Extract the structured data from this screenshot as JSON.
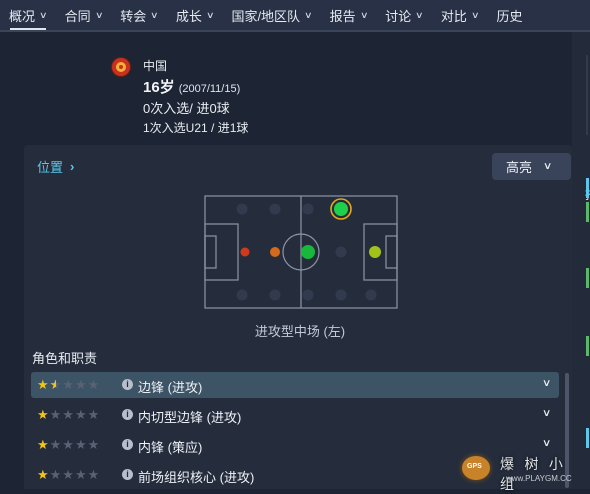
{
  "nav": {
    "tabs": [
      {
        "label": "概况",
        "active": true
      },
      {
        "label": "合同"
      },
      {
        "label": "转会"
      },
      {
        "label": "成长"
      },
      {
        "label": "国家/地区队"
      },
      {
        "label": "报告"
      },
      {
        "label": "讨论"
      },
      {
        "label": "对比"
      },
      {
        "label": "历史"
      }
    ]
  },
  "player": {
    "nation": "中国",
    "age": "16岁",
    "dob": "(2007/11/15)",
    "caps": "0次入选/ 进0球",
    "u21": "1次入选U21 / 进1球"
  },
  "position": {
    "link_label": "位置",
    "dropdown_label": "高亮",
    "position_label": "进攻型中场 (左)",
    "markers": [
      {
        "name": "amc-left",
        "color": "#1ed04a",
        "highlight": true
      },
      {
        "name": "mc",
        "color": "#18b83c"
      },
      {
        "name": "amc",
        "color": "#a2c21a"
      },
      {
        "name": "dm",
        "color": "#d56a1c"
      },
      {
        "name": "dc",
        "color": "#d03a1c"
      }
    ]
  },
  "roles": {
    "heading": "角色和职责",
    "items": [
      {
        "rating": 1.5,
        "label": "边锋 (进攻)",
        "selected": true
      },
      {
        "rating": 1,
        "label": "内切型边锋 (进攻)"
      },
      {
        "rating": 1,
        "label": "内锋 (策应)"
      },
      {
        "rating": 1,
        "label": "前场组织核心 (进攻)"
      }
    ]
  },
  "side_panel": {
    "label": "指"
  },
  "watermark": {
    "name": "爆 树 小 组",
    "url": "www.PLAYGM.CC",
    "logo_text": "GPS"
  }
}
